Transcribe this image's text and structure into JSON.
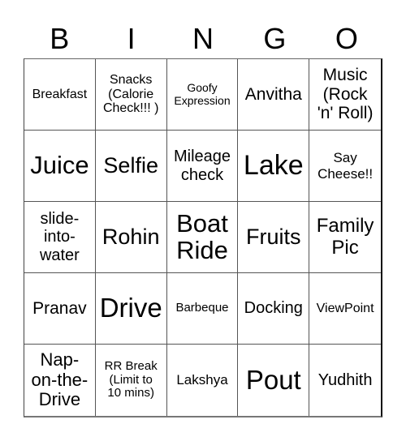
{
  "card": {
    "header": [
      "B",
      "I",
      "N",
      "G",
      "O"
    ],
    "cells": [
      "Breakfast",
      "Snacks (Calorie Check!!! )",
      "Goofy Expression",
      "Anvitha",
      "Music (Rock 'n' Roll)",
      "Juice",
      "Selfie",
      "Mileage check",
      "Lake",
      "Say Cheese!!",
      "slide-into-water",
      "Rohin",
      "Boat Ride",
      "Fruits",
      "Family Pic",
      "Pranav",
      "Drive",
      "Barbeque",
      "Docking",
      "ViewPoint",
      "Nap-on-the-Drive",
      "RR Break (Limit to 10 mins)",
      "Lakshya",
      "Pout",
      "Yudhith"
    ]
  },
  "display_lines": {
    "r0c1": [
      "Snacks",
      "(Calorie",
      "Check!!! )"
    ],
    "r0c2": [
      "Goofy",
      "Expression"
    ],
    "r0c4": [
      "Music",
      "(Rock",
      "'n' Roll)"
    ],
    "r1c2": [
      "Mileage",
      "check"
    ],
    "r1c4": [
      "Say",
      "Cheese!!"
    ],
    "r2c0": [
      "slide-",
      "into-",
      "water"
    ],
    "r2c2": [
      "Boat",
      "Ride"
    ],
    "r2c4": [
      "Family",
      "Pic"
    ],
    "r4c0": [
      "Nap-",
      "on-the-",
      "Drive"
    ],
    "r4c1": [
      "RR Break",
      "(Limit to",
      "10 mins)"
    ]
  }
}
